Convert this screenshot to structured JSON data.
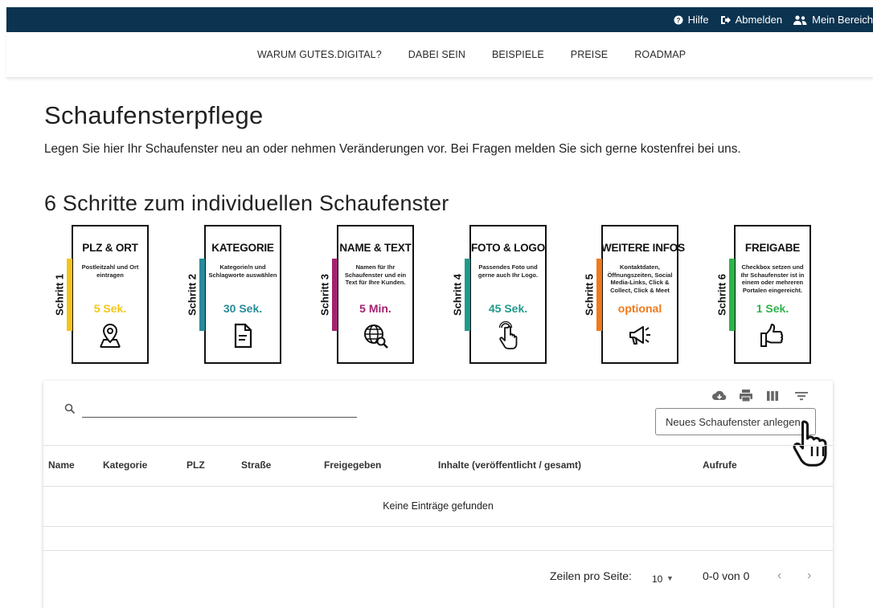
{
  "topbar": {
    "help_label": "Hilfe",
    "logout_label": "Abmelden",
    "account_label": "Mein Bereich"
  },
  "nav": {
    "items": [
      "WARUM GUTES.DIGITAL?",
      "DABEI SEIN",
      "BEISPIELE",
      "PREISE",
      "ROADMAP"
    ]
  },
  "page": {
    "title": "Schaufensterpflege",
    "intro": "Legen Sie hier Ihr Schaufenster neu an oder nehmen Veränderungen vor. Bei Fragen melden Sie sich gerne kostenfrei bei uns.",
    "steps_heading": "6 Schritte zum individuellen Schaufenster"
  },
  "steps": [
    {
      "label": "Schritt 1",
      "title": "PLZ & ORT",
      "desc": "Postleitzahl und Ort eintragen",
      "time": "5 Sek.",
      "color": "#f5c518",
      "icon": "location-pin-icon"
    },
    {
      "label": "Schritt 2",
      "title": "KATEGORIE",
      "desc": "Kategorie/n und Schlagworte auswählen",
      "time": "30 Sek.",
      "color": "#2a8a9a",
      "icon": "document-icon"
    },
    {
      "label": "Schritt 3",
      "title": "NAME & TEXT",
      "desc": "Namen für Ihr Schaufenster und ein Text für Ihre Kunden.",
      "time": "5 Min.",
      "color": "#a3236f",
      "icon": "globe-search-icon"
    },
    {
      "label": "Schritt 4",
      "title": "FOTO & LOGO",
      "desc": "Passendes Foto und gerne auch Ihr Logo.",
      "time": "45 Sek.",
      "color": "#1f9a8a",
      "icon": "touch-icon"
    },
    {
      "label": "Schritt 5",
      "title": "WEITERE INFOS",
      "desc": "Kontaktdaten, Öffnungszeiten, Social Media-Links, Click & Collect, Click & Meet",
      "time": "optional",
      "color": "#ef7a1a",
      "icon": "megaphone-icon"
    },
    {
      "label": "Schritt 6",
      "title": "FREIGABE",
      "desc": "Checkbox setzen und Ihr Schaufenster ist in einem oder mehreren Portalen eingereicht.",
      "time": "1 Sek.",
      "color": "#2eb34a",
      "icon": "thumbs-up-icon"
    }
  ],
  "table": {
    "search_placeholder": "",
    "new_button": "Neues Schaufenster anlegen",
    "columns": [
      "Name",
      "Kategorie",
      "PLZ",
      "Straße",
      "Freigegeben",
      "Inhalte (veröffentlicht / gesamt)",
      "Aufrufe"
    ],
    "empty_text": "Keine Einträge gefunden",
    "rows_per_page_label": "Zeilen pro Seite:",
    "rows_per_page_value": "10",
    "range_text": "0-0 von 0"
  }
}
